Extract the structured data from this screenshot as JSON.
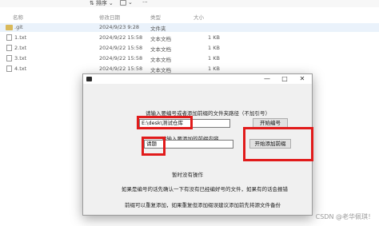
{
  "explorer": {
    "toolbar": {
      "sort_label": "排序",
      "view_icon": "view-icon",
      "more": "···"
    },
    "columns": {
      "name": "名称",
      "modified": "修改日期",
      "type": "类型",
      "size": "大小"
    },
    "rows": [
      {
        "name": ".git",
        "modified": "2024/9/23 9:28",
        "type": "文件夹",
        "size": ""
      },
      {
        "name": "1.txt",
        "modified": "2024/9/22 15:58",
        "type": "文本文档",
        "size": "1 KB"
      },
      {
        "name": "2.txt",
        "modified": "2024/9/22 15:58",
        "type": "文本文档",
        "size": "1 KB"
      },
      {
        "name": "3.txt",
        "modified": "2024/9/22 15:58",
        "type": "文本文档",
        "size": "1 KB"
      },
      {
        "name": "4.txt",
        "modified": "2024/9/22 15:58",
        "type": "文本文档",
        "size": "1 KB"
      }
    ]
  },
  "window": {
    "controls": {
      "minimize": "—",
      "maximize": "□",
      "close": "✕"
    },
    "folder_prompt": "请输入要编号或者添加前缀的文件夹路径（不加引号）",
    "folder_value": "E:\\desk\\测试仓库",
    "start_number_button": "开始编号",
    "prefix_prompt": "请输入要添加的前缀内容",
    "prefix_value": "请题",
    "start_prefix_button": "开始添加前缀",
    "status": "暂时没有操作",
    "hint1": "如果是编号的话先确认一下有没有已经编好号的文件，如果有的话会报错",
    "hint2": "前缀可以重复添加，如果重复但添加缀误建议添加前先将源文件备份"
  },
  "watermark": "CSDN @老华佩琪！",
  "colors": {
    "highlight": "#e11b1b",
    "window_bg": "#f0f0f0"
  }
}
